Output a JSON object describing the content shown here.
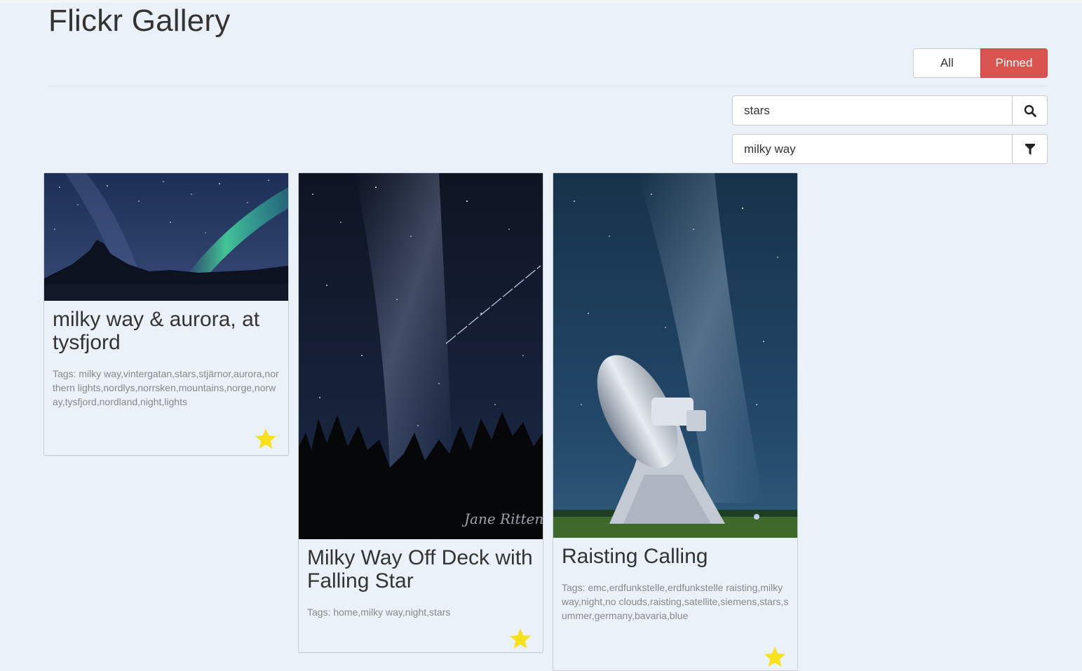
{
  "app": {
    "title": "Flickr Gallery"
  },
  "view_toggle": {
    "all_label": "All",
    "pinned_label": "Pinned",
    "active": "Pinned",
    "active_color": "#d9534f"
  },
  "search": {
    "value": "stars",
    "icon": "search-icon"
  },
  "filter": {
    "value": "milky way",
    "icon": "filter-icon"
  },
  "photos": [
    {
      "title": "milky way & aurora, at tysfjord",
      "tags": "Tags: milky way,vintergatan,stars,stjärnor,aurora,northern lights,nordlys,norrsken,mountains,norge,norway,tysfjord,nordland,night,lights",
      "pinned": true
    },
    {
      "title": "Milky Way Off Deck with Falling Star",
      "tags": "Tags: home,milky way,night,stars",
      "pinned": true
    },
    {
      "title": "Raisting Calling",
      "tags": "Tags: emc,erdfunkstelle,erdfunkstelle raisting,milky way,night,no clouds,raisting,satellite,siemens,stars,summer,germany,bavaria,blue",
      "pinned": true
    }
  ],
  "colors": {
    "background": "#ebf1f9",
    "star": "#f7e01c",
    "pinned_button": "#d9534f"
  }
}
